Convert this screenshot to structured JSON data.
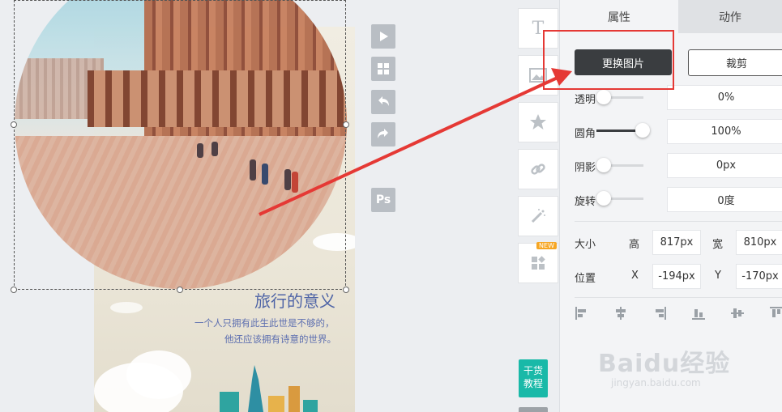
{
  "canvas": {
    "title": "旅行的意义",
    "subtitle_line1": "一个人只拥有此生此世是不够的，",
    "subtitle_line2": "他还应该拥有诗意的世界。"
  },
  "floating_toolbar": {
    "icons": [
      "play-icon",
      "grid-icon",
      "undo-icon",
      "redo-icon",
      "photoshop-icon"
    ],
    "ps_label": "Ps"
  },
  "tool_column": {
    "text_tool_glyph": "T",
    "new_badge": "NEW",
    "tutorial_line1": "干货",
    "tutorial_line2": "教程"
  },
  "panel": {
    "tabs": [
      "属性",
      "动作"
    ],
    "replace_image_label": "更换图片",
    "crop_label": "裁剪",
    "properties": [
      {
        "label": "透明",
        "value": "0%",
        "slider_fraction": 0
      },
      {
        "label": "圆角",
        "value": "100%",
        "slider_fraction": 1
      },
      {
        "label": "阴影",
        "value": "0px",
        "slider_fraction": 0
      },
      {
        "label": "旋转",
        "value": "0度",
        "slider_fraction": 0
      }
    ],
    "size": {
      "label": "大小",
      "height_label": "高",
      "height_value": "817px",
      "width_label": "宽",
      "width_value": "810px"
    },
    "position": {
      "label": "位置",
      "x_label": "X",
      "x_value": "-194px",
      "y_label": "Y",
      "y_value": "-170px"
    }
  },
  "watermark": {
    "main": "Baidu经验",
    "sub": "jingyan.baidu.com"
  },
  "colors": {
    "accent_dark": "#3a3d40",
    "annotation_red": "#e53935",
    "title_blue": "#4e64a6",
    "tutorial_teal": "#19b9a8"
  }
}
